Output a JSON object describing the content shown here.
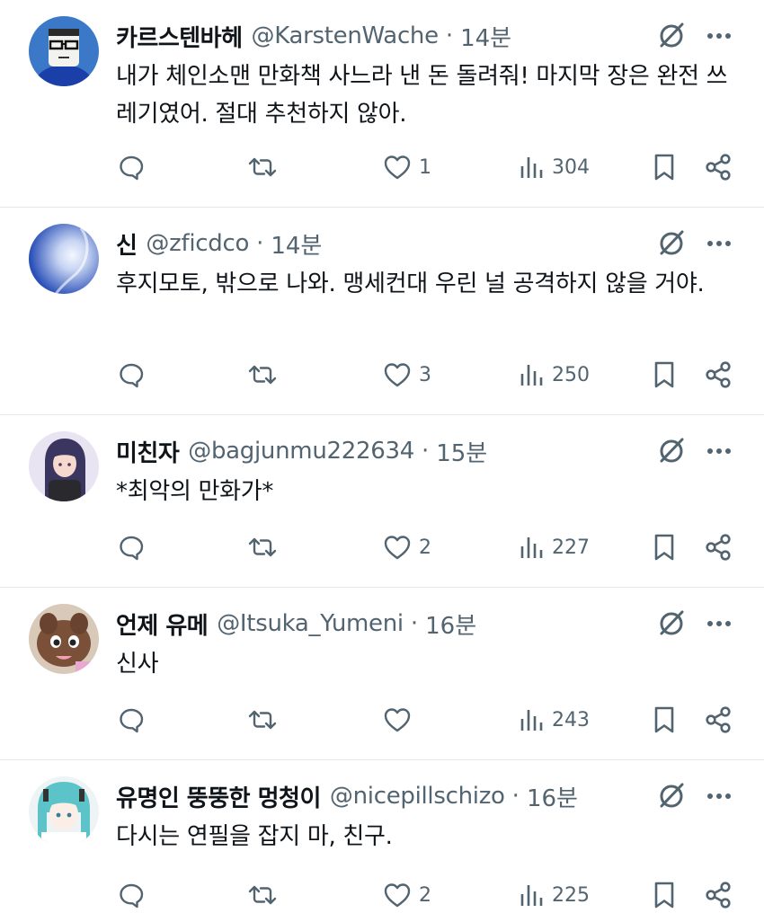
{
  "tweets": [
    {
      "name": "카르스텐바헤",
      "handle": "@KarstenWache",
      "dot": "·",
      "time": "14분",
      "text": "내가 체인소맨 만화책 사느라 낸 돈 돌려줘! 마지막 장은 완전 쓰레기였어. 절대 추천하지 않아.",
      "likes": "1",
      "views": "304",
      "avatar": "avatar-glasses-character"
    },
    {
      "name": "신",
      "handle": "@zficdco",
      "dot": "·",
      "time": "14분",
      "text": "후지모토, 밖으로 나와. 맹세컨대 우린 널 공격하지 않을 거야.",
      "likes": "3",
      "views": "250",
      "avatar": "avatar-blue-orb"
    },
    {
      "name": "미친자",
      "handle": "@bagjunmu222634",
      "dot": "·",
      "time": "15분",
      "text": "*최악의 만화가*",
      "likes": "2",
      "views": "227",
      "avatar": "avatar-anime-girl-dark-hair"
    },
    {
      "name": "언제 유메",
      "handle": "@Itsuka_Yumeni",
      "dot": "·",
      "time": "16분",
      "text": "신사",
      "likes": "",
      "views": "243",
      "avatar": "avatar-brown-creature"
    },
    {
      "name": "유명인 뚱뚱한 멍청이",
      "handle": "@nicepillschizo",
      "dot": "·",
      "time": "16분",
      "text": "다시는 연필을 잡지 마, 친구.",
      "likes": "2",
      "views": "225",
      "avatar": "avatar-anime-girl-teal-hair"
    }
  ],
  "icons": {
    "reply": "reply-icon",
    "retweet": "retweet-icon",
    "like": "heart-icon",
    "views": "views-chart-icon",
    "bookmark": "bookmark-icon",
    "share": "share-icon",
    "grok": "grok-icon",
    "more": "more-dots-icon"
  },
  "colors": {
    "text": "#0f1419",
    "secondary": "#536471",
    "divider": "#e6e9ec"
  }
}
